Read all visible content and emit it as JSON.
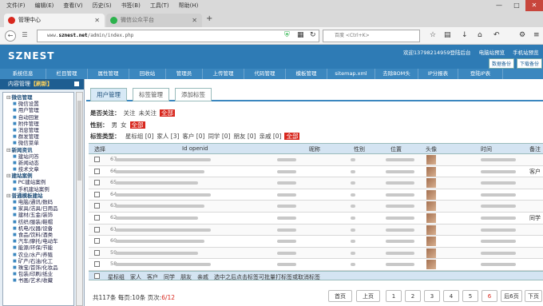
{
  "browser": {
    "menu": [
      "文件(F)",
      "编辑(E)",
      "查看(V)",
      "历史(S)",
      "书签(B)",
      "工具(T)",
      "帮助(H)"
    ],
    "tabs": [
      {
        "label": "管理中心",
        "icon": "sznest-icon",
        "color": "#d8281e"
      },
      {
        "label": "微信公众平台",
        "icon": "wechat-icon",
        "color": "#2bb24c"
      }
    ],
    "url_prefix": "www.",
    "url_domain": "sznest.net",
    "url_path": "/admin/index.php",
    "search_placeholder": "百度 <Ctrl+K>"
  },
  "header": {
    "logo": "SZNEST",
    "welcome": "欢迎13798214959登陆后台",
    "links": [
      "电脑站预览",
      "手机站预览"
    ],
    "buttons": [
      "数据备份",
      "下载备份"
    ]
  },
  "modules": [
    "系统信息",
    "栏目管理",
    "属性管理",
    "回收站",
    "管理员",
    "上传管理",
    "代码管理",
    "模板管理",
    "sitemap.xml",
    "去除BOM头",
    "IP分报表",
    "登陆IP表"
  ],
  "sidebar": {
    "title": "内容管理",
    "refresh": "【刷新】",
    "tree": [
      {
        "type": "group",
        "label": "微信管理"
      },
      {
        "type": "item",
        "label": "微信设置"
      },
      {
        "type": "item",
        "label": "用户管理"
      },
      {
        "type": "item",
        "label": "自动回复"
      },
      {
        "type": "item",
        "label": "附件管理"
      },
      {
        "type": "item",
        "label": "消息管理"
      },
      {
        "type": "item",
        "label": "群发管理"
      },
      {
        "type": "item",
        "label": "微信菜单"
      },
      {
        "type": "group",
        "label": "新闻资讯"
      },
      {
        "type": "item",
        "label": "建站问答"
      },
      {
        "type": "item",
        "label": "新闻动态"
      },
      {
        "type": "item",
        "label": "技术文章"
      },
      {
        "type": "group",
        "label": "建站案例"
      },
      {
        "type": "item",
        "label": "PC建站案例"
      },
      {
        "type": "item",
        "label": "手机建站案例"
      },
      {
        "type": "group",
        "label": "普通模板建站"
      },
      {
        "type": "item",
        "label": "电脑/通讯/数码"
      },
      {
        "type": "item",
        "label": "家具/洁具/日用品"
      },
      {
        "type": "item",
        "label": "建材/五金/装饰"
      },
      {
        "type": "item",
        "label": "纺织/服装/鞋帽"
      },
      {
        "type": "item",
        "label": "机电/仪器/设备"
      },
      {
        "type": "item",
        "label": "食品/饮料/酒类"
      },
      {
        "type": "item",
        "label": "汽车/摩托/电动车"
      },
      {
        "type": "item",
        "label": "能源/环保/节能"
      },
      {
        "type": "item",
        "label": "农业/水产/养殖"
      },
      {
        "type": "item",
        "label": "矿产/石油/化工"
      },
      {
        "type": "item",
        "label": "珠宝/首饰/化妆品"
      },
      {
        "type": "item",
        "label": "包装/印刷/纸业"
      },
      {
        "type": "item",
        "label": "书画/艺术/收藏"
      }
    ]
  },
  "subtabs": [
    "用户管理",
    "标签管理",
    "添加标签"
  ],
  "filters": {
    "follow": {
      "label": "是否关注：",
      "options": [
        "关注",
        "未关注"
      ],
      "selected": "全部"
    },
    "gender": {
      "label": "性别：",
      "options": [
        "男",
        "女"
      ],
      "selected": "全部"
    },
    "tags": {
      "label": "标签类型：",
      "options": [
        "星标组 [0]",
        "家人 [3]",
        "客户 [0]",
        "同学 [0]",
        "朋友 [0]",
        "亲戚 [0]"
      ],
      "selected": "全部"
    }
  },
  "table": {
    "columns": [
      "选择",
      "Id openid",
      "昵称",
      "性别",
      "位置",
      "头像",
      "时间",
      "备注"
    ],
    "rows": [
      {
        "id": "67",
        "remark": ""
      },
      {
        "id": "66",
        "remark": "客户"
      },
      {
        "id": "65",
        "remark": ""
      },
      {
        "id": "64",
        "remark": ""
      },
      {
        "id": "63",
        "remark": ""
      },
      {
        "id": "62",
        "remark": "同学"
      },
      {
        "id": "61",
        "remark": ""
      },
      {
        "id": "60",
        "remark": ""
      },
      {
        "id": "59",
        "remark": ""
      },
      {
        "id": "58",
        "remark": ""
      }
    ]
  },
  "bulk": {
    "options": [
      "星标组",
      "家人",
      "客户",
      "同学",
      "朋友",
      "亲戚"
    ],
    "hint": "选中之后点击标签可批量打标签或取消标签"
  },
  "pager": {
    "info_prefix": "共117条 每页:10条 页次:",
    "current": "6/12",
    "first": "首页",
    "prev": "上页",
    "pages": [
      "1",
      "2",
      "3",
      "4",
      "5",
      "6"
    ],
    "next6": "后6页",
    "next": "下页"
  },
  "colors": {
    "brand": "#2e7bb5",
    "accent": "#d8281e",
    "nav": "#3b87bf"
  }
}
